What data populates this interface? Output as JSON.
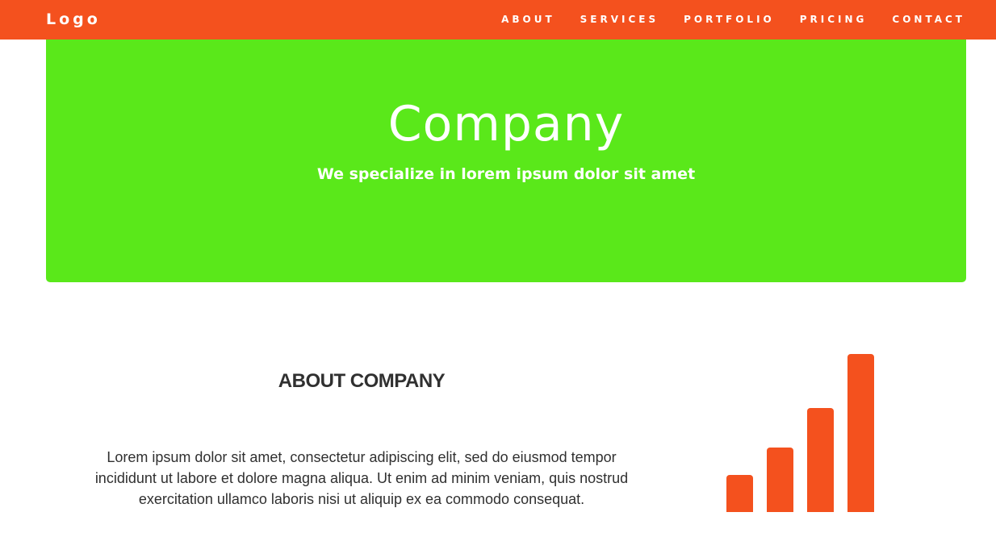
{
  "navbar": {
    "logo": "Logo",
    "links": [
      "ABOUT",
      "SERVICES",
      "PORTFOLIO",
      "PRICING",
      "CONTACT"
    ]
  },
  "hero": {
    "title": "Company",
    "subtitle": "We specialize in lorem ipsum dolor sit amet"
  },
  "about": {
    "title": "ABOUT COMPANY",
    "text": "Lorem ipsum dolor sit amet, consectetur adipiscing elit, sed do eiusmod tempor incididunt ut labore et dolore magna aliqua. Ut enim ad minim veniam, quis nostrud exercitation ullamco laboris nisi ut aliquip ex ea commodo consequat."
  },
  "icon": {
    "name": "signal-icon"
  },
  "colors": {
    "brand": "#f4511e",
    "hero": "#5ae81a",
    "text": "#303030"
  }
}
